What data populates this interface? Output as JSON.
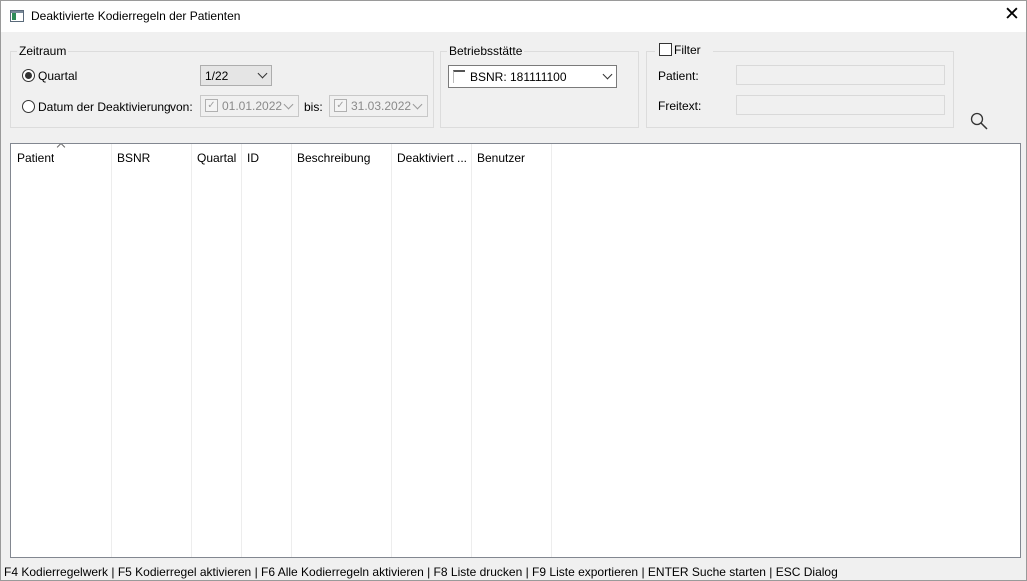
{
  "window": {
    "title": "Deaktivierte Kodierregeln der Patienten",
    "close_glyph": "✕"
  },
  "zeitraum": {
    "label": "Zeitraum",
    "quartal_label": "Quartal",
    "quartal_selected": true,
    "quartal_value": "1/22",
    "datum_label": "Datum der Deaktivierung",
    "von_label": "von:",
    "von_value": "01.01.2022",
    "bis_label": "bis:",
    "bis_value": "31.03.2022"
  },
  "betriebsstaette": {
    "label": "Betriebsstätte",
    "value": "BSNR: 181111100"
  },
  "filter": {
    "label": "Filter",
    "checked": false,
    "patient_label": "Patient:",
    "patient_value": "",
    "freitext_label": "Freitext:",
    "freitext_value": ""
  },
  "table": {
    "columns": [
      "Patient",
      "BSNR",
      "Quartal",
      "ID",
      "Beschreibung",
      "Deaktiviert ...",
      "Benutzer"
    ],
    "sorted_column": "Patient",
    "rows": []
  },
  "statusbar": {
    "text": "F4 Kodierregelwerk | F5 Kodierregel aktivieren | F6 Alle Kodierregeln aktivieren | F8 Liste drucken | F9 Liste exportieren | ENTER Suche starten | ESC Dialog"
  },
  "icons": {
    "app": "app-window-icon",
    "search": "search-icon",
    "close": "close-icon"
  }
}
